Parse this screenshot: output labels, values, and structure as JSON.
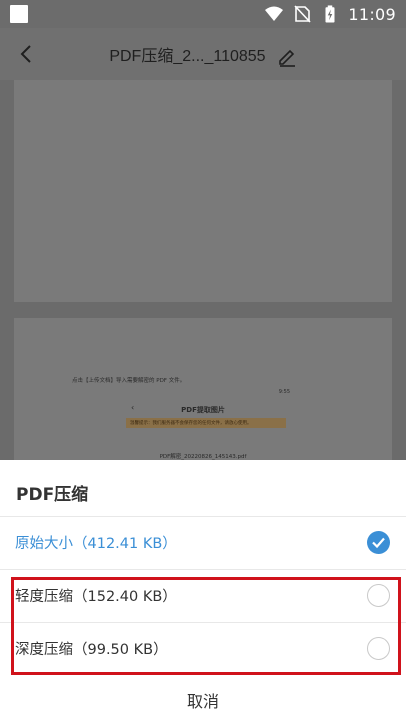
{
  "status_bar": {
    "time": "11:09",
    "icons": [
      "wifi-icon",
      "no-sim-icon",
      "battery-charging-icon"
    ]
  },
  "header": {
    "title": "PDF压缩_2..._110855",
    "back_icon": "chevron-left-icon",
    "edit_icon": "pencil-icon"
  },
  "preview": {
    "instruction": "点击【上传文档】导入需要解密的 PDF 文件。",
    "status_text": "9:55",
    "screen_title": "PDF提取图片",
    "notice": "温馨提示：我们服务器不会保存您的任何文件，请放心使用。",
    "file_name": "PDF解密_20220826_145143.pdf"
  },
  "sheet": {
    "title": "PDF压缩",
    "options": [
      {
        "label": "原始大小（412.41 KB）",
        "selected": true
      },
      {
        "label": "轻度压缩（152.40 KB）",
        "selected": false
      },
      {
        "label": "深度压缩（99.50 KB）",
        "selected": false
      }
    ],
    "cancel_label": "取消"
  },
  "colors": {
    "accent": "#3b8fd6",
    "highlight_border": "#d0121b",
    "overlay": "#6b6b6b"
  }
}
